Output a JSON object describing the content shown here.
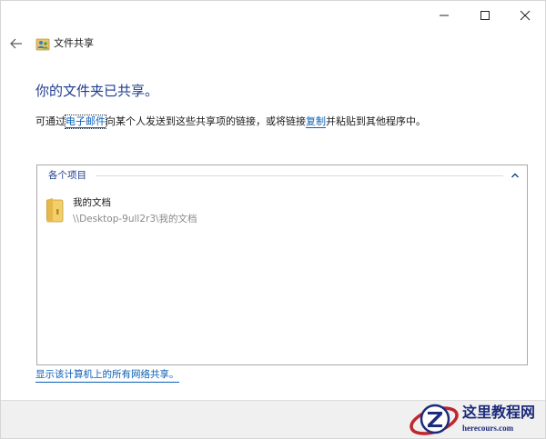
{
  "window": {
    "title": "文件共享",
    "controls": {
      "minimize_icon": "minimize-icon",
      "maximize_icon": "maximize-icon",
      "close_icon": "close-icon"
    }
  },
  "nav": {
    "back_icon": "back-arrow-icon",
    "app_icon": "sharing-users-icon",
    "title": "文件共享"
  },
  "main": {
    "heading": "你的文件夹已共享。",
    "description": {
      "prefix": "可通过",
      "email_link": "电子邮件",
      "middle": "向某个人发送到这些共享项的链接，或将链接",
      "copy_link": "复制",
      "suffix": "并粘贴到其他程序中。"
    },
    "items_group": {
      "header": "各个项目",
      "chevron_icon": "chevron-up-icon",
      "items": [
        {
          "icon": "folder-icon",
          "name": "我的文档",
          "path": "\\\\Desktop-9ull2r3\\我的文档"
        }
      ]
    },
    "show_all_link": "显示该计算机上的所有网络共享。"
  },
  "watermark": {
    "logo_icon": "z-logo-icon",
    "title": "这里教程网",
    "url": "herecours.com"
  },
  "colors": {
    "heading": "#1e3d8f",
    "link": "#0a5fb5",
    "path_gray": "#8a8a8a",
    "footer_bg": "#f0f0f0",
    "watermark_blue": "#1d2c7a",
    "watermark_red": "#c0262d"
  }
}
